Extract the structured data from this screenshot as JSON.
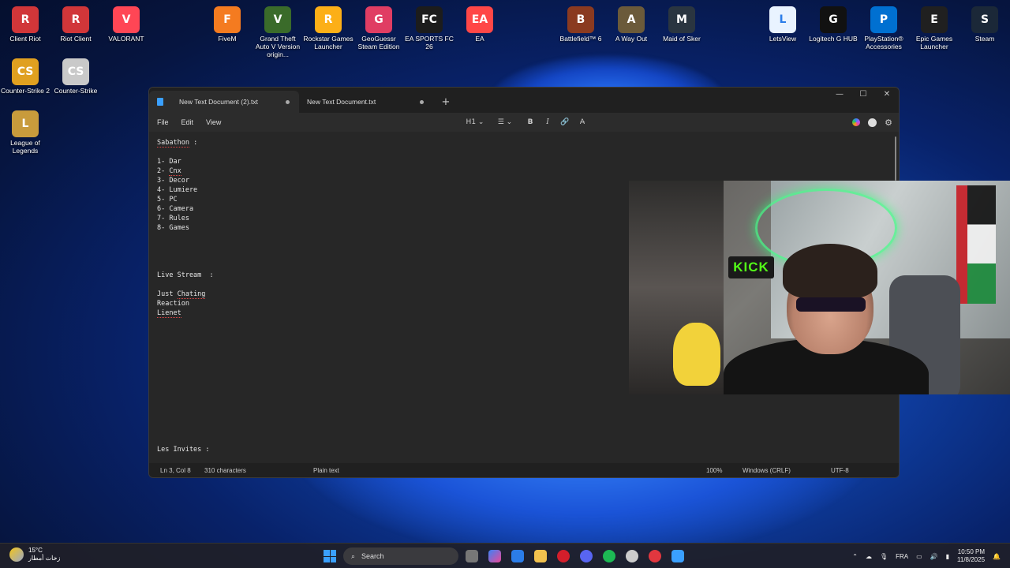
{
  "desktop_icons": [
    {
      "label": "Client Riot",
      "color": "#d13639",
      "glyph": "R"
    },
    {
      "label": "Riot Client",
      "color": "#d13639",
      "glyph": "R"
    },
    {
      "label": "VALORANT",
      "color": "#ff4655",
      "glyph": "V"
    },
    {
      "label": "FiveM",
      "color": "#f47b20",
      "glyph": "F"
    },
    {
      "label": "Grand Theft Auto V Version origin...",
      "color": "#3a6b2a",
      "glyph": "V"
    },
    {
      "label": "Rockstar Games Launcher",
      "color": "#fcaf17",
      "glyph": "R"
    },
    {
      "label": "GeoGuessr Steam Edition",
      "color": "#e03d63",
      "glyph": "G"
    },
    {
      "label": "EA SPORTS FC 26",
      "color": "#1c1c1c",
      "glyph": "FC"
    },
    {
      "label": "EA",
      "color": "#ff4747",
      "glyph": "EA"
    },
    {
      "label": "Battlefield™ 6",
      "color": "#8a3a20",
      "glyph": "B"
    },
    {
      "label": "A Way Out",
      "color": "#6b5a3a",
      "glyph": "A"
    },
    {
      "label": "Maid of Sker",
      "color": "#2a3540",
      "glyph": "M"
    },
    {
      "label": "LetsView",
      "color": "#e9f3ff",
      "glyph": "L"
    },
    {
      "label": "Logitech G HUB",
      "color": "#111111",
      "glyph": "G"
    },
    {
      "label": "PlayStation® Accessories",
      "color": "#0070d1",
      "glyph": "P"
    },
    {
      "label": "Epic Games Launcher",
      "color": "#202020",
      "glyph": "E"
    },
    {
      "label": "Steam",
      "color": "#1b2838",
      "glyph": "S"
    },
    {
      "label": "Counter-Strike 2",
      "color": "#e0a020",
      "glyph": "CS"
    },
    {
      "label": "Counter-Strike",
      "color": "#c9c9c9",
      "glyph": "CS"
    },
    {
      "label": "League of Legends",
      "color": "#c89b3c",
      "glyph": "L"
    }
  ],
  "notepad": {
    "tabs": [
      {
        "title": "New Text Document (2).txt"
      },
      {
        "title": "New Text Document.txt"
      }
    ],
    "window_controls": {
      "minimize": "—",
      "maximize": "☐",
      "close": "✕"
    },
    "menu": [
      "File",
      "Edit",
      "View"
    ],
    "toolbar": {
      "heading": "H1 ⌄",
      "list": "☰ ⌄",
      "bold": "B",
      "italic": "I",
      "link": "🔗",
      "clear": "A̶"
    },
    "lines": [
      {
        "text": "Sabathon :"
      },
      {
        "text": ""
      },
      {
        "text": "1- Dar"
      },
      {
        "text": "2- Cnx"
      },
      {
        "text": "3- Decor"
      },
      {
        "text": "4- Lumiere"
      },
      {
        "text": "5- PC"
      },
      {
        "text": "6- Camera"
      },
      {
        "text": "7- Rules"
      },
      {
        "text": "8- Games"
      },
      {
        "text": ""
      },
      {
        "text": ""
      },
      {
        "text": ""
      },
      {
        "text": ""
      },
      {
        "text": "Live Stream  :"
      },
      {
        "text": ""
      },
      {
        "text": "Just Chating"
      },
      {
        "text": "Reaction"
      },
      {
        "text": "Lienet"
      }
    ],
    "bottom_line": "Les Invites :",
    "status": {
      "position": "Ln 3, Col 8",
      "chars": "310 characters",
      "format": "Plain text",
      "zoom": "100%",
      "line_ending": "Windows (CRLF)",
      "encoding": "UTF-8"
    }
  },
  "webcam": {
    "sign": "KICK"
  },
  "taskbar": {
    "weather_temp": "15°C",
    "weather_desc": "زخات أمطار",
    "search": "Search",
    "language": "FRA",
    "time": "10:50 PM",
    "date": "11/8/2025"
  }
}
